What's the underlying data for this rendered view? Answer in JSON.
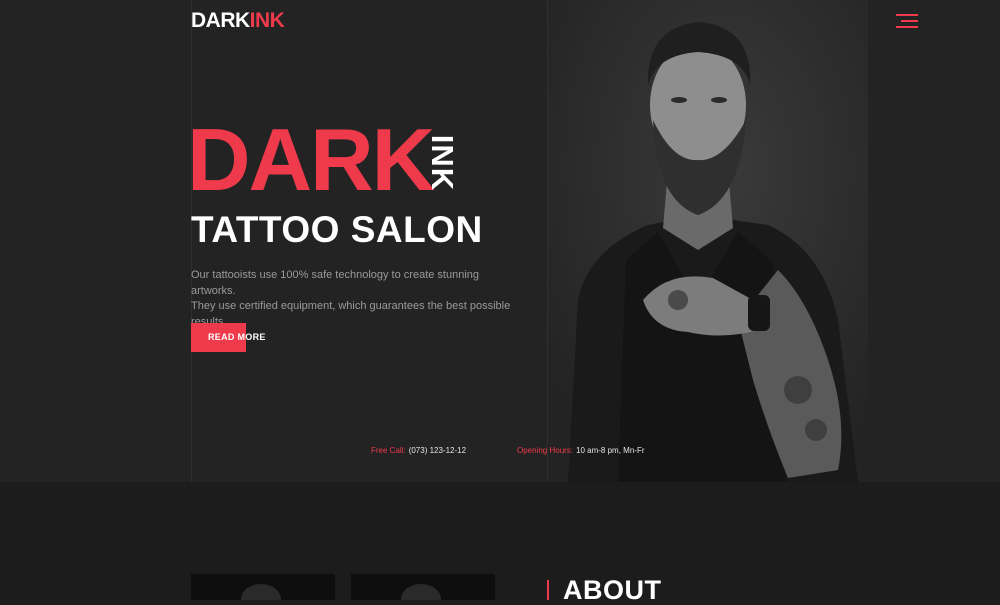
{
  "header": {
    "logo_dark": "DARK",
    "logo_ink": "INK",
    "menu_icon": "hamburger-menu-icon"
  },
  "hero": {
    "title_dark": "DARK",
    "title_ink": "INK",
    "subtitle": "TATTOO SALON",
    "description_line1": "Our tattooists use 100% safe technology to create stunning artworks.",
    "description_line2": "They use certified equipment, which guarantees the best possible results.",
    "button_label": "READ MORE"
  },
  "contact": {
    "call_label": "Free Call:",
    "call_value": "(073) 123-12-12",
    "hours_label": "Opening Hours:",
    "hours_value": "10 am-8 pm, Mn-Fr"
  },
  "about": {
    "title": "ABOUT"
  },
  "colors": {
    "accent": "#ee3a4a",
    "background": "#232323",
    "text": "#ffffff",
    "muted_text": "#9a9a9a"
  }
}
